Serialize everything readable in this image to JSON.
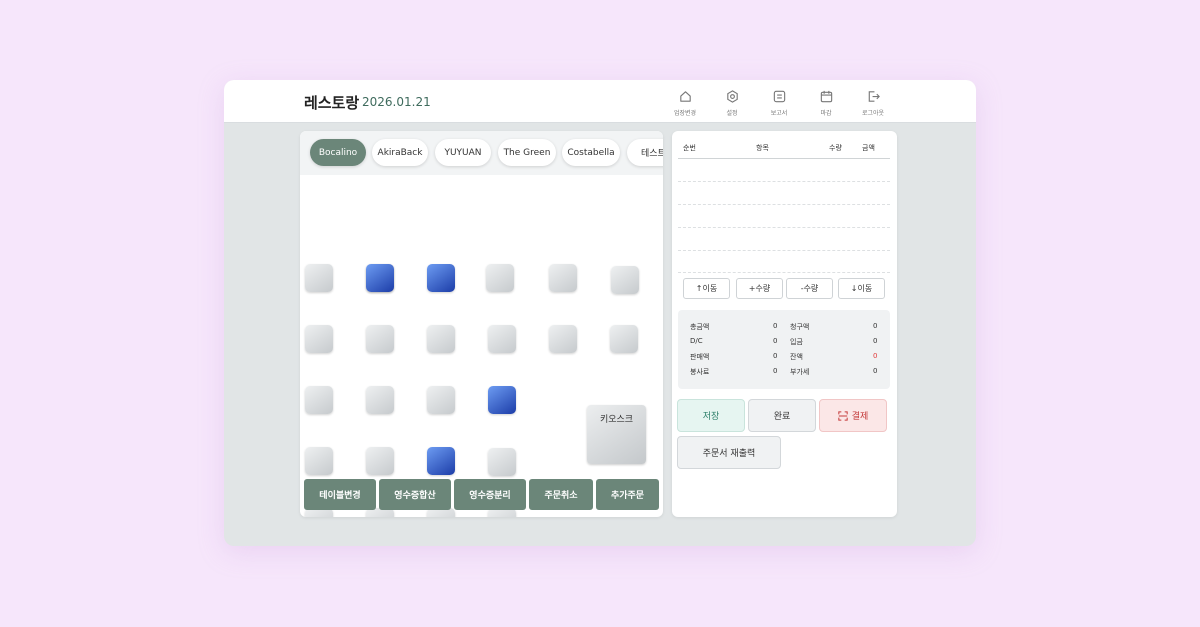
{
  "header": {
    "title": "레스토랑",
    "date": "2026.01.21",
    "nav": [
      {
        "label": "업장변경",
        "icon": "home-icon"
      },
      {
        "label": "설정",
        "icon": "gear-icon"
      },
      {
        "label": "보고서",
        "icon": "report-icon"
      },
      {
        "label": "마감",
        "icon": "calendar-icon"
      },
      {
        "label": "로그아웃",
        "icon": "logout-icon"
      }
    ]
  },
  "stores": {
    "tabs": [
      "Bocalino",
      "AkiraBack",
      "YUYUAN",
      "The Green",
      "Costabella",
      "테스트"
    ],
    "active_tab": "Bocalino",
    "kiosk_label": "키오스크",
    "actions": [
      "테이블변경",
      "영수증합산",
      "영수증분리",
      "주문취소",
      "추가주문"
    ]
  },
  "order": {
    "columns": {
      "no": "순번",
      "item": "항목",
      "qty": "수량",
      "amount": "금액"
    },
    "controls": [
      "↑이동",
      "+수량",
      "-수량",
      "↓이동"
    ],
    "summary": {
      "total_label": "총금액",
      "total": "0",
      "billed_label": "청구액",
      "billed": "0",
      "dc_label": "D/C",
      "dc": "0",
      "paid_label": "입금",
      "paid": "0",
      "sales_label": "판매액",
      "sales": "0",
      "balance_label": "잔액",
      "balance": "0",
      "service_label": "봉사료",
      "service": "0",
      "vat_label": "부가세",
      "vat": "0"
    },
    "buttons": {
      "save": "저장",
      "complete": "완료",
      "pay": "결제",
      "reprint": "주문서 재출력"
    }
  },
  "colors": {
    "accent": "#6b8679",
    "active_table": "#2f55c9",
    "balance": "#e03a3a"
  }
}
